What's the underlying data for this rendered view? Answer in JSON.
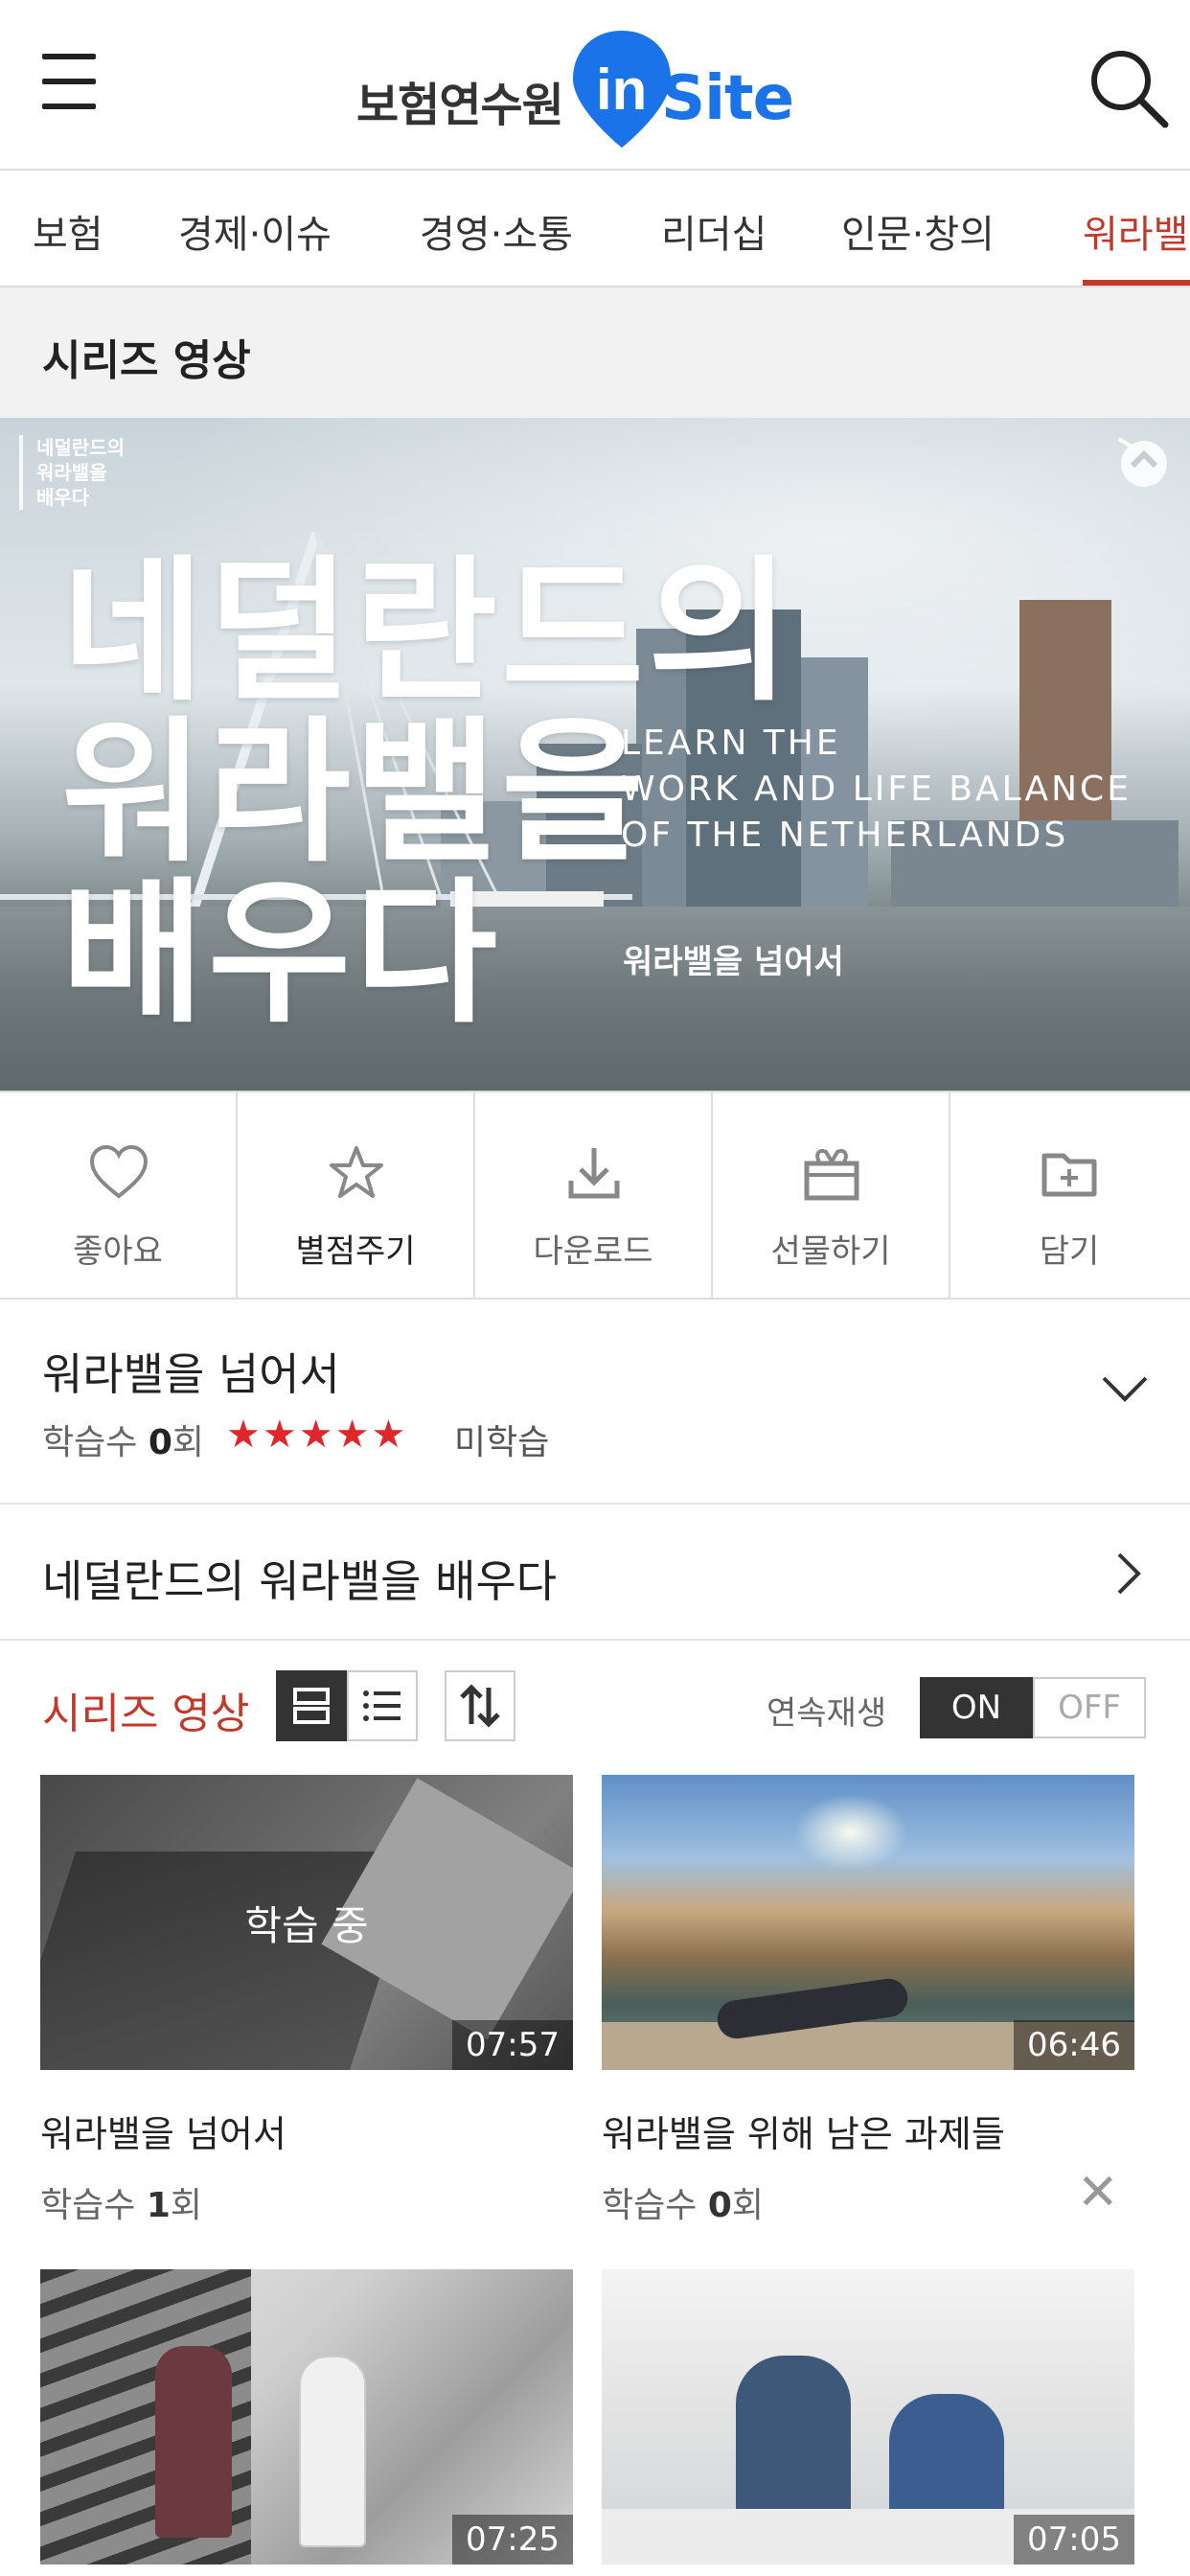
{
  "header": {
    "logo_kr": "보험연수원",
    "logo_in": "in",
    "logo_site": "Site"
  },
  "tabs": [
    {
      "label": "보험",
      "active": false
    },
    {
      "label": "경제·이슈",
      "active": false
    },
    {
      "label": "경영·소통",
      "active": false
    },
    {
      "label": "리더십",
      "active": false
    },
    {
      "label": "인문·창의",
      "active": false
    },
    {
      "label": "워라밸",
      "active": true
    }
  ],
  "section_title": "시리즈 영상",
  "hero": {
    "corner_text": "네덜란드의\n워라밸을\n배우다",
    "title_kr": "네덜란드의\n워라밸을\n배우다",
    "title_en": "LEARN THE\nWORK AND LIFE BALANCE\nOF THE NETHERLANDS",
    "subtitle": "워라밸을 넘어서"
  },
  "actions": [
    {
      "label": "좋아요",
      "icon": "heart-icon"
    },
    {
      "label": "별점주기",
      "icon": "star-outline-icon"
    },
    {
      "label": "다운로드",
      "icon": "download-icon"
    },
    {
      "label": "선물하기",
      "icon": "gift-icon"
    },
    {
      "label": "담기",
      "icon": "folder-add-icon"
    }
  ],
  "video": {
    "title": "워라밸을 넘어서",
    "views_prefix": "학습수",
    "views_count": "0",
    "views_suffix": "회",
    "rating_stars": "★★★★★",
    "rating": 5,
    "status": "미학습"
  },
  "series_link": "네덜란드의 워라밸을 배우다",
  "series_toolbar": {
    "label": "시리즈 영상",
    "autoplay_label": "연속재생",
    "on_label": "ON",
    "off_label": "OFF"
  },
  "cards": [
    {
      "title": "워라밸을 넘어서",
      "views_prefix": "학습수",
      "views_count": "1",
      "views_suffix": "회",
      "duration": "07:57",
      "overlay": "학습 중"
    },
    {
      "title": "워라밸을 위해 남은 과제들",
      "views_prefix": "학습수",
      "views_count": "0",
      "views_suffix": "회",
      "duration": "06:46"
    },
    {
      "duration": "07:25"
    },
    {
      "duration": "07:05"
    }
  ],
  "colors": {
    "accent": "#c0392b",
    "star": "#e0262b",
    "logo_blue": "#1a73e8"
  }
}
